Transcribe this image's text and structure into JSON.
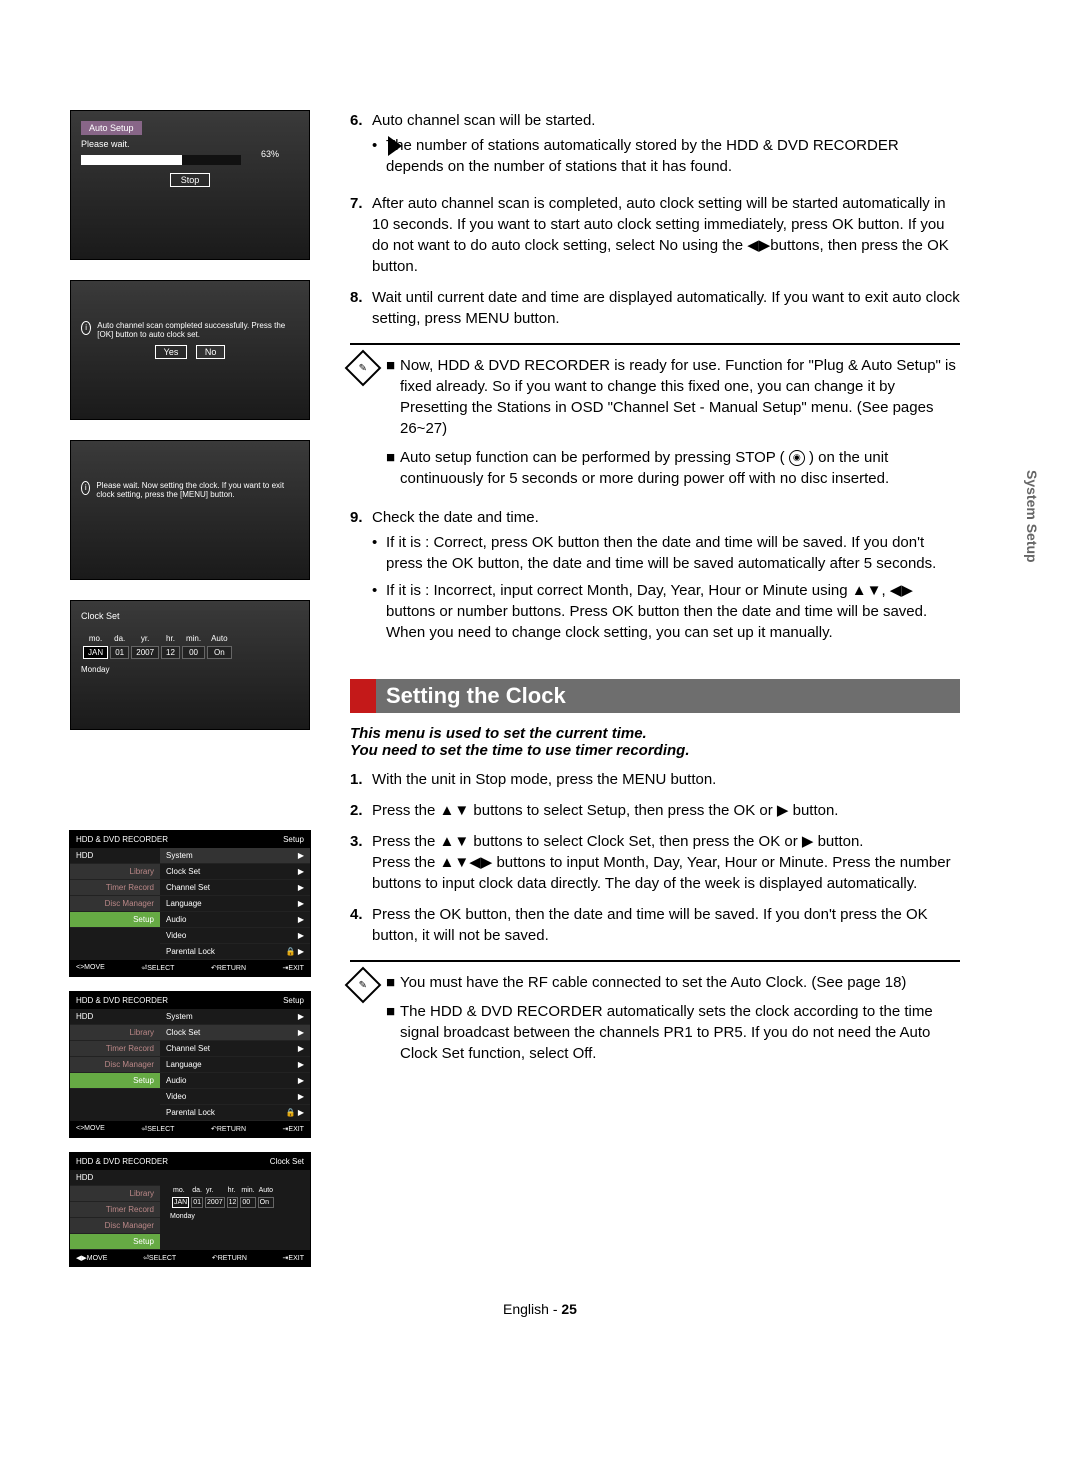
{
  "side_tab": "System Setup",
  "osd1": {
    "tab": "Auto Setup",
    "wait": "Please wait.",
    "pct": "63%",
    "stop": "Stop"
  },
  "osd2": {
    "msg": "Auto channel scan completed successfully. Press the [OK] button to auto clock set.",
    "yes": "Yes",
    "no": "No"
  },
  "osd3": {
    "msg": "Please wait. Now setting the clock. If you want to exit clock setting, press the [MENU] button."
  },
  "osd4": {
    "title": "Clock Set",
    "headers": [
      "mo.",
      "da.",
      "yr.",
      "hr.",
      "min.",
      "Auto"
    ],
    "values": [
      "JAN",
      "01",
      "2007",
      "12",
      "00",
      "On"
    ],
    "weekday": "Monday"
  },
  "osd_menu": {
    "title_left": "HDD & DVD RECORDER",
    "title_right_setup": "Setup",
    "title_right_clock": "Clock Set",
    "left_items": [
      "HDD",
      "Library",
      "Timer Record",
      "Disc Manager",
      "Setup"
    ],
    "right_items": [
      "System",
      "Clock Set",
      "Channel Set",
      "Language",
      "Audio",
      "Video",
      "Parental Lock"
    ],
    "footer": [
      "<>MOVE",
      "⏎SELECT",
      "↶RETURN",
      "⇥EXIT"
    ],
    "footer_lr": [
      "◀▶MOVE",
      "⏎SELECT",
      "↶RETURN",
      "⇥EXIT"
    ]
  },
  "steps_top": {
    "s6": {
      "n": "6.",
      "text": "Auto channel scan will be started.",
      "b1": "The number of stations automatically stored by the HDD & DVD RECORDER depends on the number of stations that it has found."
    },
    "s7": {
      "n": "7.",
      "text": "After auto channel scan is completed, auto clock setting will be started automatically in 10 seconds. If you want to start auto clock setting immediately, press OK button. If you do not want to do auto clock setting, select No using the ◀▶buttons, then press the OK button."
    },
    "s8": {
      "n": "8.",
      "text": "Wait until current date and time are displayed automatically. If you want to exit auto clock setting, press MENU button."
    }
  },
  "notes1": {
    "n1": "Now, HDD & DVD RECORDER is ready for use. Function for \"Plug & Auto Setup\" is fixed already. So if you want to change this fixed one, you can change it by Presetting the Stations in OSD \"Channel Set - Manual Setup\" menu. (See pages 26~27)",
    "n2a": "Auto setup function can be performed by pressing STOP (",
    "n2b": ") on the unit continuously for 5 seconds or more during power off with no disc inserted."
  },
  "steps_mid": {
    "s9": {
      "n": "9.",
      "text": "Check the date and time.",
      "b1": "If it is : Correct, press OK button then the date and time will be saved. If you don't press the OK button, the date and time will be saved automatically after 5 seconds.",
      "b2": "If it is : Incorrect, input correct Month, Day, Year, Hour or Minute using ▲▼, ◀▶ buttons or number buttons. Press OK button then the date and time will be saved. When you need to change clock setting, you can set up it manually."
    }
  },
  "section2": {
    "title": "Setting the Clock",
    "subtitle": "This menu is used to set the current time.\nYou need to set the time to use timer recording.",
    "s1": {
      "n": "1.",
      "text": "With the unit in Stop mode, press the MENU button."
    },
    "s2": {
      "n": "2.",
      "text": "Press the ▲▼ buttons to select Setup, then press the OK or ▶ button."
    },
    "s3": {
      "n": "3.",
      "text_a": "Press the ▲▼ buttons to select Clock Set, then press the OK or ▶ button.",
      "text_b": "Press the ▲▼◀▶ buttons to input Month, Day, Year, Hour or Minute. Press the number buttons to input clock data directly. The day of the week is displayed automatically."
    },
    "s4": {
      "n": "4.",
      "text": "Press the OK button, then the date and time will be saved. If you don't press the OK button, it will not be saved."
    }
  },
  "notes2": {
    "n1": "You must have the RF cable connected to set the Auto Clock. (See page 18)",
    "n2": "The HDD & DVD RECORDER automatically sets the clock according to the time signal broadcast between the channels PR1 to PR5. If you do not need the Auto Clock Set function, select Off."
  },
  "footer": {
    "lang": "English",
    "dash": " - ",
    "page": "25"
  }
}
